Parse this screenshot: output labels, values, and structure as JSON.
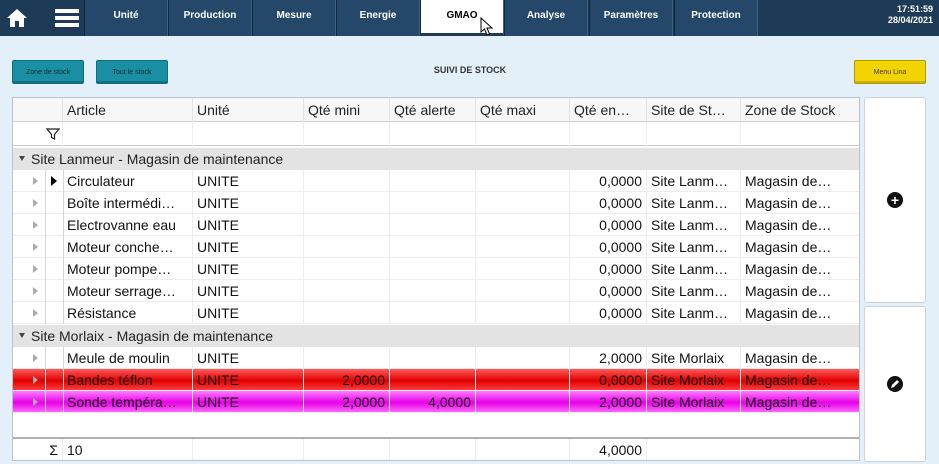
{
  "topbar": {
    "tabs": [
      "Unité",
      "Production",
      "Mesure",
      "Energie",
      "GMAO",
      "Analyse",
      "Paramètres",
      "Protection"
    ],
    "active_tab": "GMAO",
    "clock": {
      "time": "17:51:59",
      "date": "28/04/2021"
    }
  },
  "toolbar": {
    "zone_stock_label": "Zone de stock",
    "tout_stock_label": "Tout le stock",
    "title": "SUIVI DE STOCK",
    "menu_label": "Menu Lina"
  },
  "grid": {
    "columns": [
      "Article",
      "Unité",
      "Qté mini",
      "Qté alerte",
      "Qté maxi",
      "Qté en…",
      "Site de St…",
      "Zone de Stock"
    ],
    "groups": [
      {
        "label": "Site Lanmeur - Magasin de maintenance",
        "rows": [
          {
            "article": "Circulateur",
            "unite": "UNITE",
            "mini": "",
            "alerte": "",
            "maxi": "",
            "qte": "0,0000",
            "site": "Site Lanm…",
            "zone": "Magasin de…",
            "style": "normal",
            "current": true
          },
          {
            "article": "Boîte intermédi…",
            "unite": "UNITE",
            "mini": "",
            "alerte": "",
            "maxi": "",
            "qte": "0,0000",
            "site": "Site Lanm…",
            "zone": "Magasin de…",
            "style": "normal"
          },
          {
            "article": "Electrovanne eau",
            "unite": "UNITE",
            "mini": "",
            "alerte": "",
            "maxi": "",
            "qte": "0,0000",
            "site": "Site Lanm…",
            "zone": "Magasin de…",
            "style": "normal"
          },
          {
            "article": "Moteur conche…",
            "unite": "UNITE",
            "mini": "",
            "alerte": "",
            "maxi": "",
            "qte": "0,0000",
            "site": "Site Lanm…",
            "zone": "Magasin de…",
            "style": "normal"
          },
          {
            "article": "Moteur pompe…",
            "unite": "UNITE",
            "mini": "",
            "alerte": "",
            "maxi": "",
            "qte": "0,0000",
            "site": "Site Lanm…",
            "zone": "Magasin de…",
            "style": "normal"
          },
          {
            "article": "Moteur serrage…",
            "unite": "UNITE",
            "mini": "",
            "alerte": "",
            "maxi": "",
            "qte": "0,0000",
            "site": "Site Lanm…",
            "zone": "Magasin de…",
            "style": "normal"
          },
          {
            "article": "Résistance",
            "unite": "UNITE",
            "mini": "",
            "alerte": "",
            "maxi": "",
            "qte": "0,0000",
            "site": "Site Lanm…",
            "zone": "Magasin de…",
            "style": "normal"
          }
        ]
      },
      {
        "label": "Site Morlaix - Magasin de maintenance",
        "rows": [
          {
            "article": "Meule de moulin",
            "unite": "UNITE",
            "mini": "",
            "alerte": "",
            "maxi": "",
            "qte": "2,0000",
            "site": "Site Morlaix",
            "zone": "Magasin de…",
            "style": "normal"
          },
          {
            "article": "Bandes téflon",
            "unite": "UNITE",
            "mini": "2,0000",
            "alerte": "",
            "maxi": "",
            "qte": "0,0000",
            "site": "Site Morlaix",
            "zone": "Magasin de…",
            "style": "red"
          },
          {
            "article": "Sonde tempéra…",
            "unite": "UNITE",
            "mini": "2,0000",
            "alerte": "4,0000",
            "maxi": "",
            "qte": "2,0000",
            "site": "Site Morlaix",
            "zone": "Magasin de…",
            "style": "magenta"
          }
        ]
      }
    ],
    "footer": {
      "sigma": "Σ",
      "count": "10",
      "qte_total": "4,0000"
    }
  },
  "side": {
    "add_icon": "plus-circle-icon",
    "edit_icon": "pencil-circle-icon"
  },
  "colors": {
    "nav_bg": "#1d3a57",
    "teal": "#1a8ea3",
    "yellow": "#f2d400",
    "red_row": "#e00000",
    "magenta_row": "#e800e8"
  }
}
